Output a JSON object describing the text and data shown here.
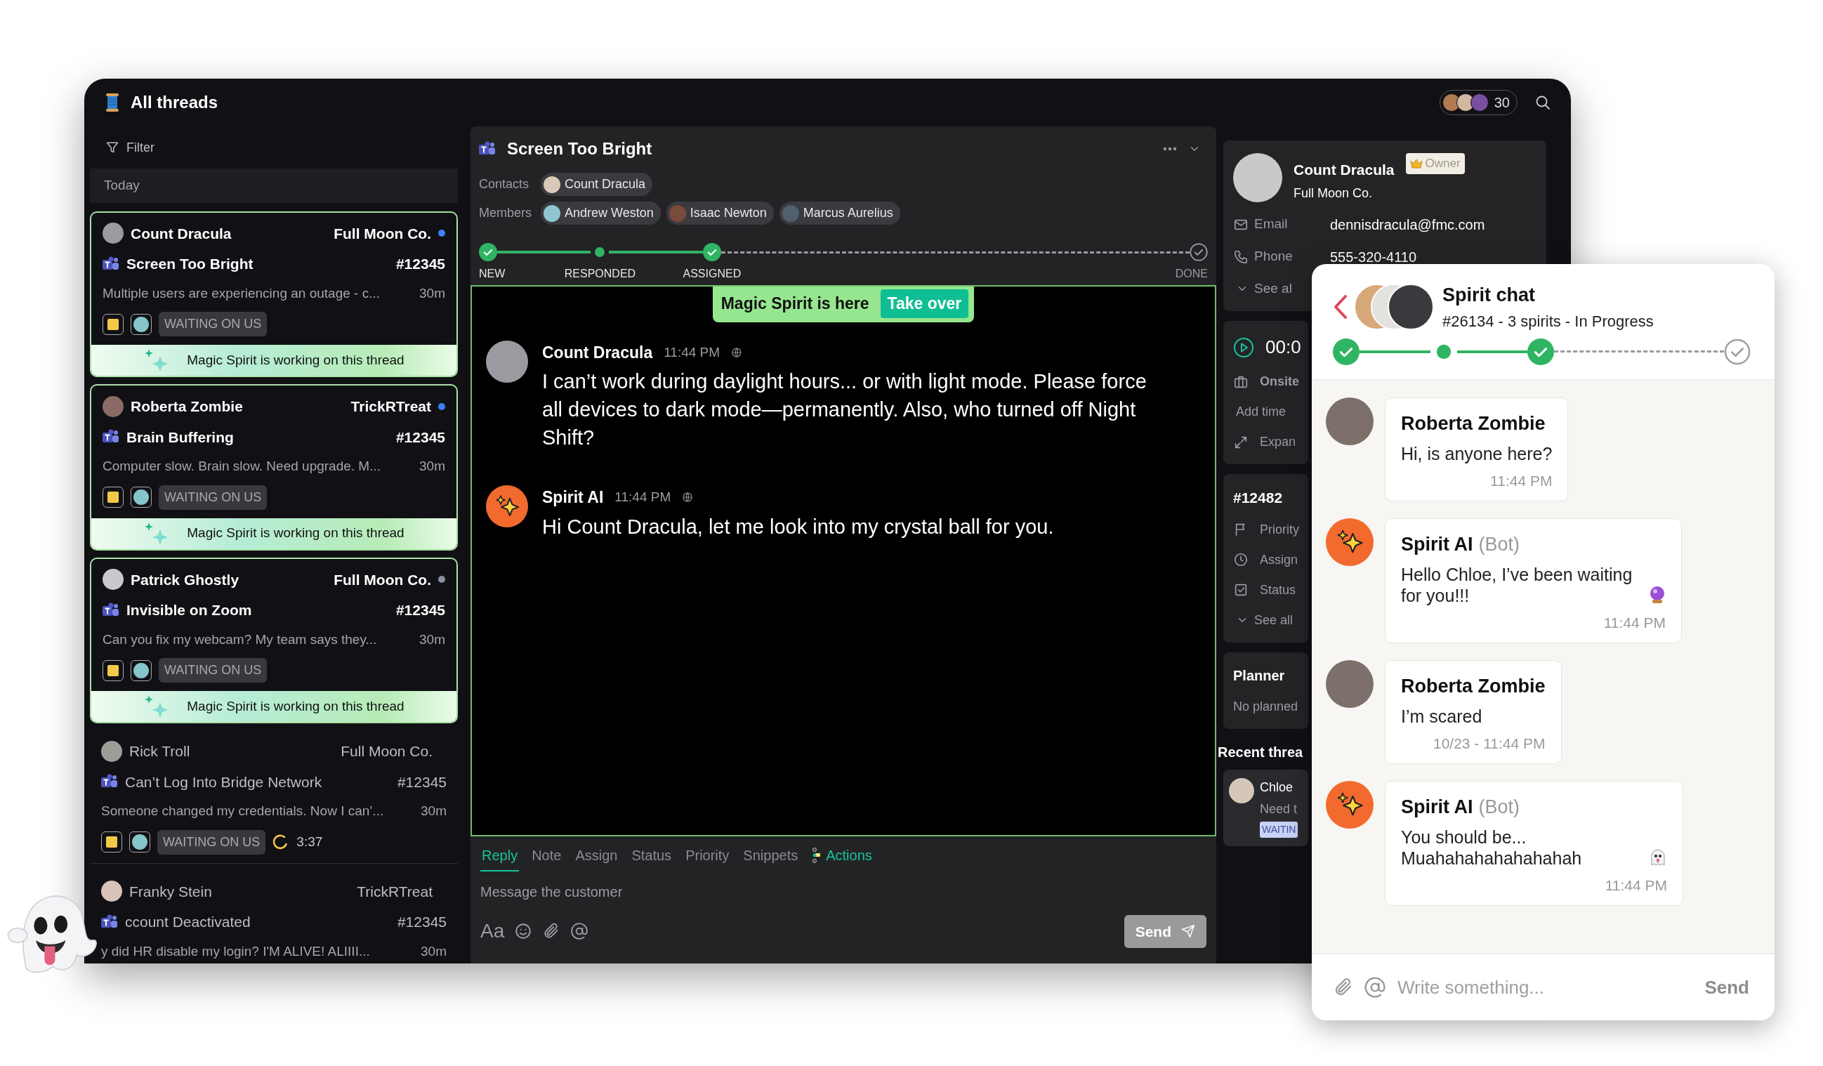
{
  "app": {
    "title": "All threads",
    "viewer_count": "30",
    "filter": "Filter",
    "group_label": "Today"
  },
  "threads": [
    {
      "name": "Count Dracula",
      "company": "Full Moon Co.",
      "subject": "Screen Too Bright",
      "number": "#12345",
      "snippet": "Multiple users are experiencing an outage - c...",
      "age": "30m",
      "status": "WAITING ON US",
      "color": "#3b82f6",
      "highlighted": true,
      "banner": "Magic Spirit is working on this thread"
    },
    {
      "name": "Roberta Zombie",
      "company": "TrickRTreat",
      "subject": "Brain Buffering",
      "number": "#12345",
      "snippet": "Computer slow. Brain slow. Need upgrade. M...",
      "age": "30m",
      "status": "WAITING ON US",
      "color": "#3b82f6",
      "highlighted": true,
      "banner": "Magic Spirit is working on this thread"
    },
    {
      "name": "Patrick Ghostly",
      "company": "Full Moon Co.",
      "subject": "Invisible on Zoom",
      "number": "#12345",
      "snippet": "Can you fix my webcam? My team says they...",
      "age": "30m",
      "status": "WAITING ON US",
      "color": "#8a8fa0",
      "highlighted": true,
      "banner": "Magic Spirit is working on this thread"
    },
    {
      "name": "Rick Troll",
      "company": "Full Moon Co.",
      "subject": "Can’t Log Into Bridge Network",
      "number": "#12345",
      "snippet": "Someone changed my credentials. Now I can’...",
      "age": "30m",
      "status": "WAITING ON US",
      "timer": "3:37",
      "highlighted": false
    },
    {
      "name": "Franky Stein",
      "company": "TrickRTreat",
      "subject": "ccount Deactivated",
      "number": "#12345",
      "snippet": "y did HR disable my login? I'M ALIVE! ALIIII...",
      "age": "30m",
      "highlighted": false
    }
  ],
  "ticket": {
    "title": "Screen Too Bright",
    "contacts_label": "Contacts",
    "contacts": [
      "Count Dracula"
    ],
    "members_label": "Members",
    "members": [
      "Andrew Weston",
      "Isaac Newton",
      "Marcus Aurelius"
    ],
    "steps": [
      {
        "label": "NEW",
        "kind": "check",
        "done": true
      },
      {
        "label": "RESPONDED",
        "kind": "dot",
        "done": true
      },
      {
        "label": "ASSIGNED",
        "kind": "check",
        "done": true
      },
      {
        "label": "DONE",
        "kind": "check",
        "done": false
      }
    ]
  },
  "spirit_banner": {
    "text": "Magic Spirit is here",
    "action": "Take over"
  },
  "messages": [
    {
      "kind": "person",
      "author": "Count Dracula",
      "time": "11:44 PM",
      "text": "I can’t work during daylight hours... or with light mode. Please force all devices to dark mode—permanently. Also, who turned off Night Shift?"
    },
    {
      "kind": "bot",
      "author": "Spirit AI",
      "time": "11:44 PM",
      "text": "Hi Count Dracula, let me look into my crystal ball for you."
    }
  ],
  "composer": {
    "tabs": [
      {
        "label": "Reply",
        "selected": true
      },
      {
        "label": "Note",
        "selected": false
      },
      {
        "label": "Assign",
        "selected": false
      },
      {
        "label": "Status",
        "selected": false
      },
      {
        "label": "Priority",
        "selected": false
      },
      {
        "label": "Snippets",
        "selected": false
      },
      {
        "label": "Actions",
        "selected": false,
        "kind": "action"
      }
    ],
    "placeholder": "Message the customer",
    "format_label": "Aa",
    "send": "Send"
  },
  "contact": {
    "name": "Count Dracula",
    "company": "Full Moon Co.",
    "role": "Owner",
    "fields": [
      {
        "kind": "email",
        "label": "Email",
        "value": "dennisdracula@fmc.com"
      },
      {
        "kind": "phone",
        "label": "Phone",
        "value": "555-320-4110"
      }
    ],
    "more": "See al"
  },
  "time_card": {
    "timer": "00:0",
    "location": "Onsite",
    "add_time": "Add time",
    "expand": "Expan"
  },
  "ticket_card": {
    "number": "#12482",
    "fields": [
      {
        "kind": "priority",
        "label": "Priority"
      },
      {
        "kind": "assign",
        "label": "Assign"
      },
      {
        "kind": "status",
        "label": "Status"
      }
    ],
    "more": "See all"
  },
  "planner": {
    "title": "Planner",
    "empty": "No planned"
  },
  "recent": {
    "title": "Recent threa",
    "items": [
      {
        "name": "Chloe",
        "snippet": "Need t",
        "status": "WAITIN"
      }
    ]
  },
  "spirit_chat": {
    "title": "Spirit chat",
    "subtitle": "#26134 - 3 spirits - In Progress",
    "steps": [
      {
        "kind": "check",
        "done": true
      },
      {
        "kind": "dot",
        "done": true
      },
      {
        "kind": "check",
        "done": true
      },
      {
        "kind": "check",
        "done": false
      }
    ],
    "messages": [
      {
        "kind": "person",
        "author": "Roberta Zombie",
        "text": "Hi, is anyone here?",
        "time": "11:44 PM"
      },
      {
        "kind": "bot",
        "author": "Spirit AI",
        "tag": "(Bot)",
        "text": "Hello Chloe, I’ve been waiting for you!!!",
        "icon": {
          "kind": "crystal"
        },
        "time": "11:44 PM"
      },
      {
        "kind": "person",
        "author": "Roberta Zombie",
        "text": "I’m scared",
        "time": "10/23 - 11:44 PM"
      },
      {
        "kind": "bot",
        "author": "Spirit AI",
        "tag": "(Bot)",
        "text": "You should be... Muahahahahahahahah",
        "icon": {
          "kind": "ghost"
        },
        "time": "11:44 PM"
      }
    ],
    "placeholder": "Write something...",
    "send": "Send"
  }
}
